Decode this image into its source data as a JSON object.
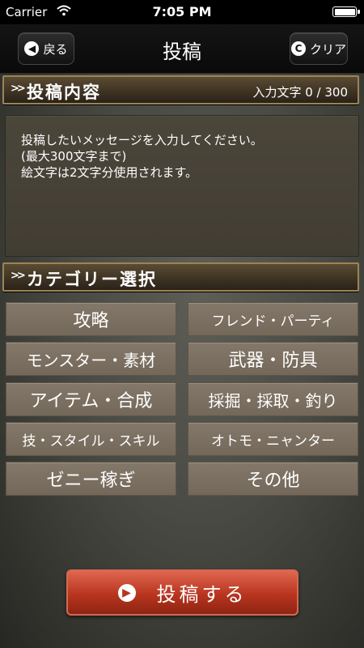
{
  "status": {
    "carrier": "Carrier",
    "time": "7:05 PM"
  },
  "nav": {
    "title": "投稿",
    "back_label": "戻る",
    "back_icon": "left-arrow",
    "clear_label": "クリア",
    "clear_icon_glyph": "C"
  },
  "post": {
    "section_title": "投稿内容",
    "counter": "入力文字 0 / 300",
    "placeholder": "投稿したいメッセージを入力してください。\n(最大300文字まで)\n絵文字は2文字分使用されます。"
  },
  "category": {
    "section_title": "カテゴリー選択",
    "items": [
      "攻略",
      "フレンド・パーティ",
      "モンスター・素材",
      "武器・防具",
      "アイテム・合成",
      "採掘・採取・釣り",
      "技・スタイル・スキル",
      "オトモ・ニャンター",
      "ゼニー稼ぎ",
      "その他"
    ]
  },
  "submit": {
    "label": "投稿する"
  },
  "colors": {
    "section_border": "#9b8455",
    "category_bg": "#7c7061",
    "submit_bg": "#b8351f"
  }
}
